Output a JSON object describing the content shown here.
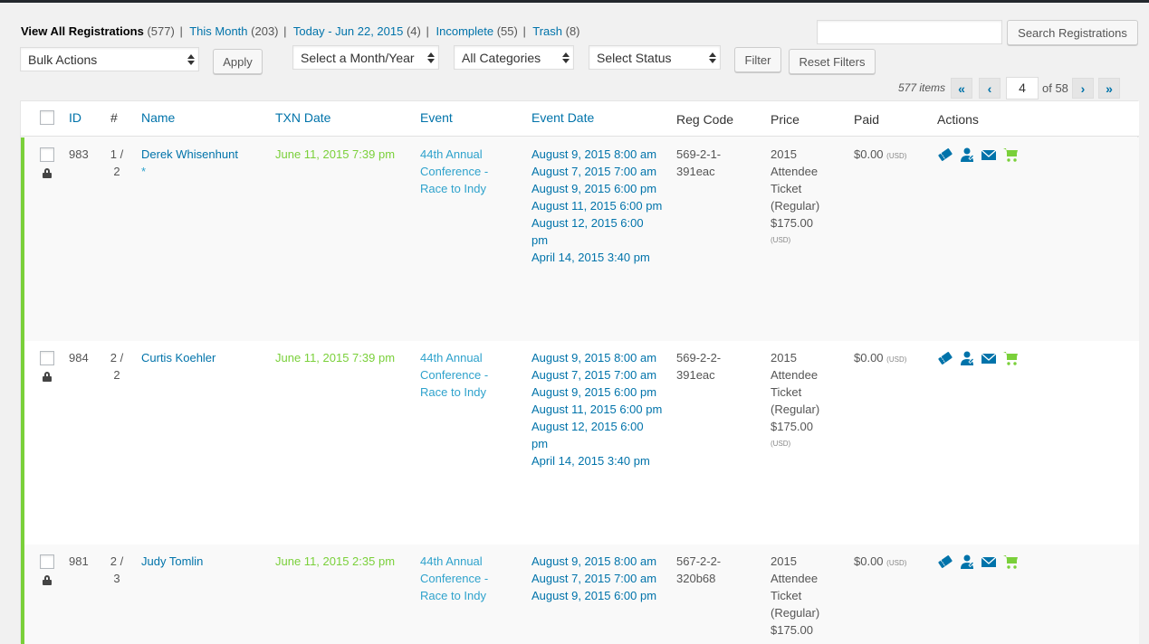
{
  "views": [
    {
      "label": "View All Registrations",
      "count": "(577)",
      "current": true
    },
    {
      "label": "This Month",
      "count": "(203)"
    },
    {
      "label": "Today - Jun 22, 2015",
      "count": "(4)"
    },
    {
      "label": "Incomplete",
      "count": "(55)"
    },
    {
      "label": "Trash",
      "count": "(8)"
    }
  ],
  "separator": "|",
  "search": {
    "button": "Search Registrations",
    "value": ""
  },
  "bulk": {
    "selected": "Bulk Actions",
    "apply": "Apply"
  },
  "filters": {
    "month": "Select a Month/Year",
    "category": "All Categories",
    "status": "Select Status",
    "filter": "Filter",
    "reset": "Reset Filters"
  },
  "pagination": {
    "items": "577 items",
    "first": "«",
    "prev": "‹",
    "current": "4",
    "of": "of 58",
    "next": "›",
    "last": "»"
  },
  "columns": {
    "id": "ID",
    "num": "#",
    "name": "Name",
    "txn_date": "TXN Date",
    "event": "Event",
    "event_date": "Event Date",
    "reg_code": "Reg Code",
    "price": "Price",
    "paid": "Paid",
    "actions": "Actions"
  },
  "rows": [
    {
      "id": "983",
      "num": [
        "1 /",
        "2"
      ],
      "name": "Derek Whisenhunt",
      "primary": "*",
      "txn": "June 11, 2015 7:39 pm",
      "event": "44th Annual Conference - Race to Indy",
      "dates": [
        "August 9, 2015 8:00 am",
        "August 7, 2015 7:00 am",
        "August 9, 2015 6:00 pm",
        "August 11, 2015 6:00 pm",
        "August 12, 2015 6:00 pm",
        "April 14, 2015 3:40 pm"
      ],
      "reg_code": "569-2-1-391eac",
      "price": "2015 Attendee Ticket (Regular) $175.00",
      "price_currency": "(USD)",
      "paid": "$0.00",
      "paid_currency": "(USD)"
    },
    {
      "id": "984",
      "num": [
        "2 /",
        "2"
      ],
      "name": "Curtis Koehler",
      "primary": "",
      "txn": "June 11, 2015 7:39 pm",
      "event": "44th Annual Conference - Race to Indy",
      "dates": [
        "August 9, 2015 8:00 am",
        "August 7, 2015 7:00 am",
        "August 9, 2015 6:00 pm",
        "August 11, 2015 6:00 pm",
        "August 12, 2015 6:00 pm",
        "April 14, 2015 3:40 pm"
      ],
      "reg_code": "569-2-2-391eac",
      "price": "2015 Attendee Ticket (Regular) $175.00",
      "price_currency": "(USD)",
      "paid": "$0.00",
      "paid_currency": "(USD)"
    },
    {
      "id": "981",
      "num": [
        "2 /",
        "3"
      ],
      "name": "Judy Tomlin",
      "primary": "",
      "txn": "June 11, 2015 2:35 pm",
      "event": "44th Annual Conference - Race to Indy",
      "dates": [
        "August 9, 2015 8:00 am",
        "August 7, 2015 7:00 am",
        "August 9, 2015 6:00 pm"
      ],
      "reg_code": "567-2-2-320b68",
      "price": "2015 Attendee Ticket (Regular) $175.00",
      "price_currency": "",
      "paid": "$0.00",
      "paid_currency": "(USD)"
    }
  ],
  "action_icons": [
    "ticket-icon",
    "contact-icon",
    "email-icon",
    "cart-icon"
  ],
  "colors": {
    "link": "#0073aa",
    "approved": "#7ad03a",
    "event": "#2ea2cc"
  }
}
